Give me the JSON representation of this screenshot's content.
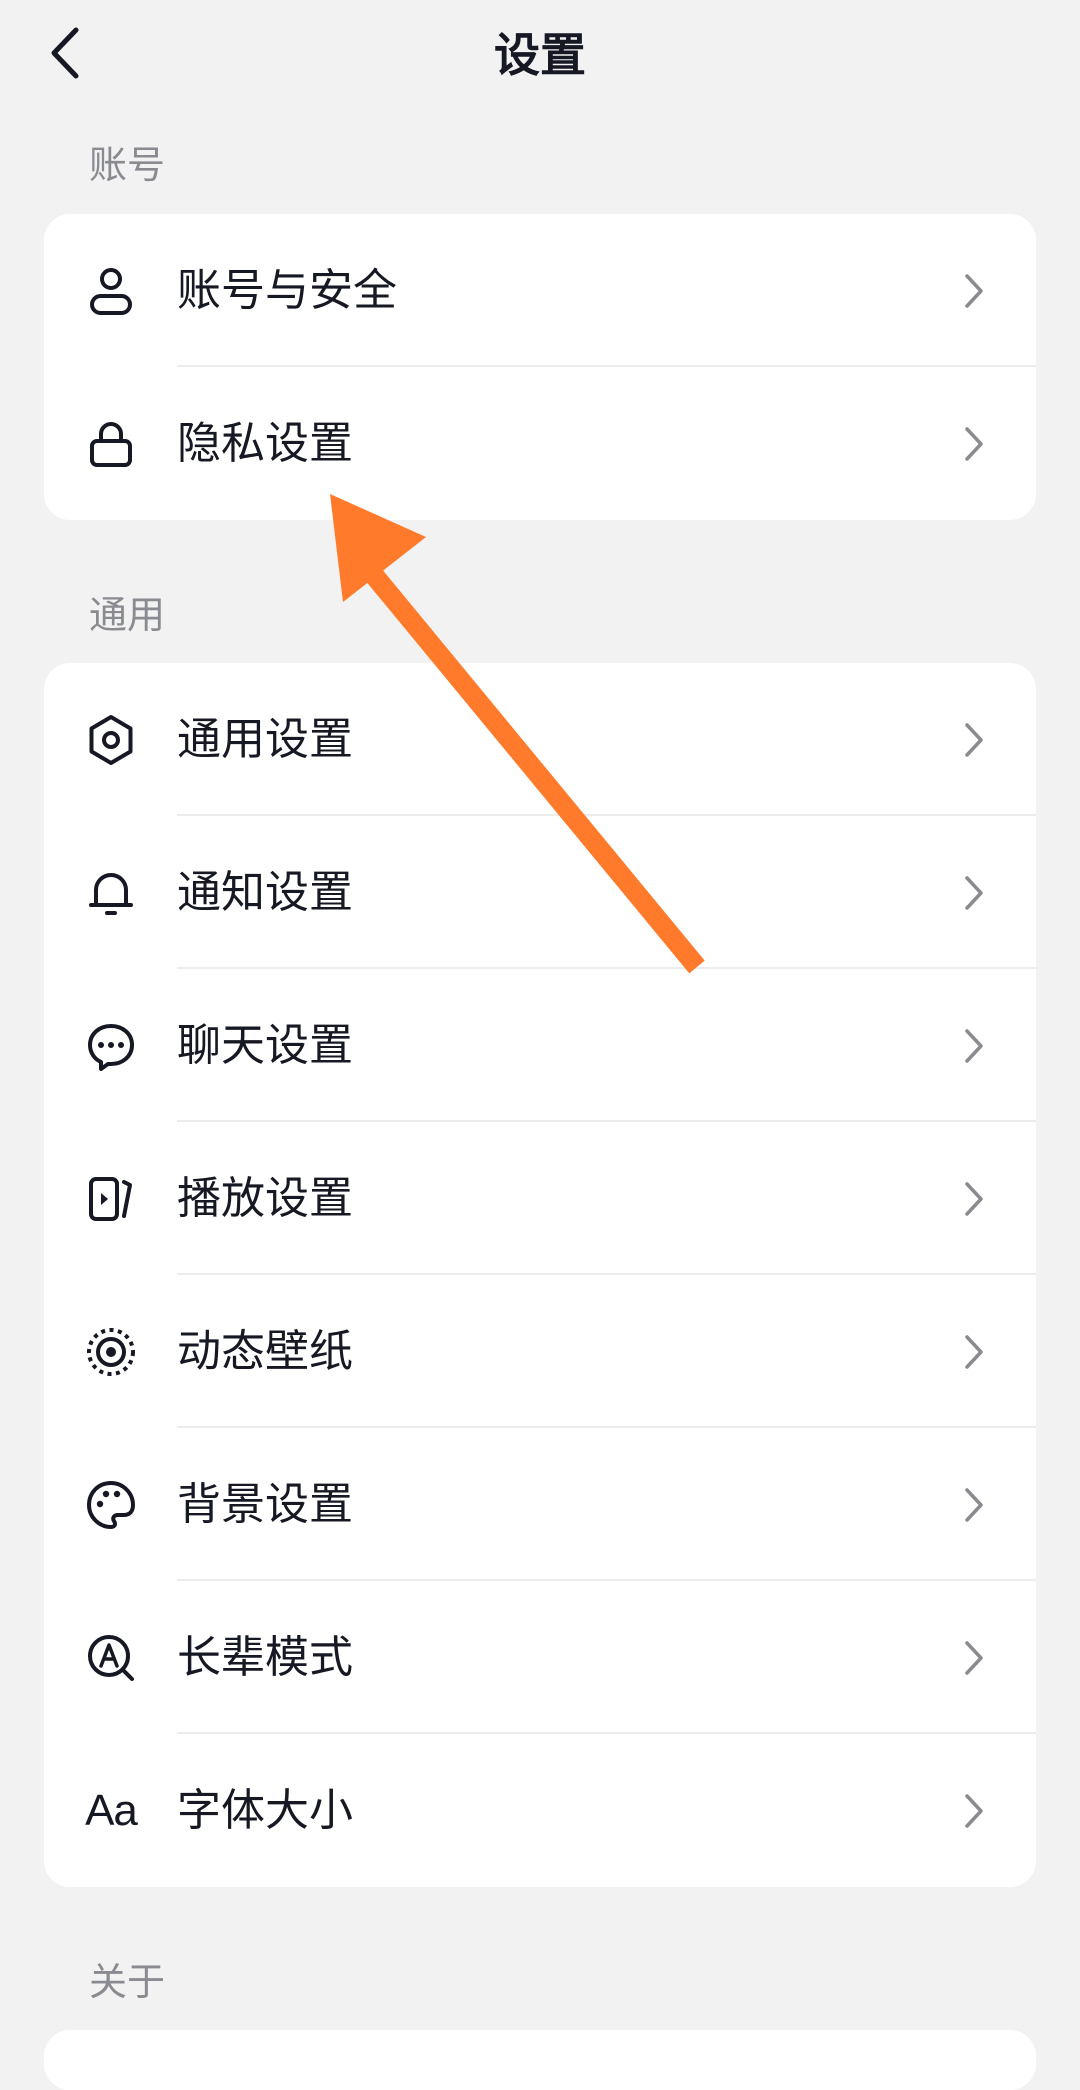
{
  "header": {
    "title": "设置"
  },
  "sections": {
    "account": {
      "title": "账号",
      "items": [
        {
          "label": "账号与安全",
          "icon": "user-icon"
        },
        {
          "label": "隐私设置",
          "icon": "lock-icon"
        }
      ]
    },
    "general": {
      "title": "通用",
      "items": [
        {
          "label": "通用设置",
          "icon": "gear-icon"
        },
        {
          "label": "通知设置",
          "icon": "bell-icon"
        },
        {
          "label": "聊天设置",
          "icon": "chat-bubble-icon"
        },
        {
          "label": "播放设置",
          "icon": "play-screen-icon"
        },
        {
          "label": "动态壁纸",
          "icon": "live-wallpaper-icon"
        },
        {
          "label": "背景设置",
          "icon": "palette-icon"
        },
        {
          "label": "长辈模式",
          "icon": "elder-mode-icon"
        },
        {
          "label": "字体大小",
          "icon": "font-size-icon",
          "icon_text": "Aa"
        }
      ]
    },
    "about": {
      "title": "关于"
    }
  },
  "colors": {
    "background": "#f2f2f2",
    "card": "#ffffff",
    "text": "#161823",
    "section_title": "#8a8b91",
    "chevron": "#8a8b91",
    "annotation_arrow": "#ff7a2b"
  }
}
